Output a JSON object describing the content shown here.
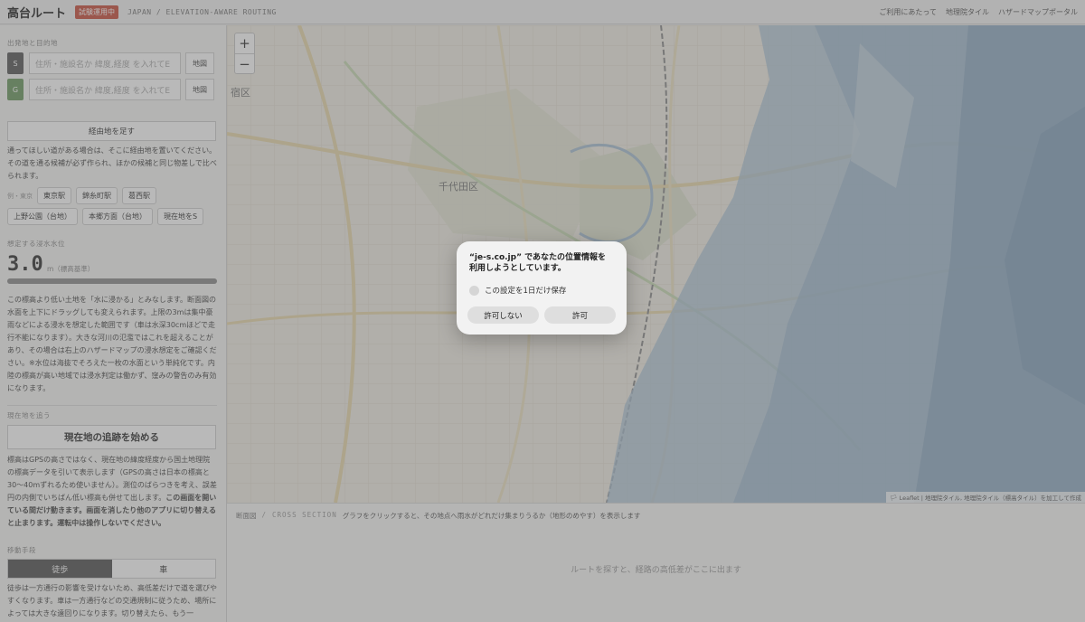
{
  "header": {
    "title": "高台ルート",
    "badge": "試験運用中",
    "subtitle": "JAPAN / ELEVATION-AWARE ROUTING",
    "links": [
      "ご利用にあたって",
      "地理院タイル",
      "ハザードマップポータル"
    ]
  },
  "sidebar": {
    "origin_dest_label": "出発地と目的地",
    "start_badge": "S",
    "goal_badge": "G",
    "input_placeholder": "住所・施設名か 緯度,経度 を入れてE",
    "map_button": "地図",
    "waypoint_button": "経由地を足す",
    "waypoint_help": "通ってほしい道がある場合は、そこに経由地を置いてください。その道を通る候補が必ず作られ、ほかの候補と同じ物差しで比べられます。",
    "examples_lead": "例・東京",
    "examples": [
      "東京駅",
      "錦糸町駅",
      "葛西駅",
      "上野公園（台地）",
      "本郷方面（台地）",
      "現在地をS"
    ],
    "water_label": "想定する浸水水位",
    "water_level_value": "3.0",
    "water_level_unit": "m（標高基準）",
    "water_level_fraction": 1.0,
    "water_help": "この標高より低い土地を「水に浸かる」とみなします。断面図の水面を上下にドラッグしても変えられます。上限の3mは集中豪雨などによる浸水を想定した範囲です（車は水深30cmほどで走行不能になります）。大きな河川の氾濫ではこれを超えることがあり、その場合は右上のハザードマップの浸水想定をご確認ください。※水位は海抜でそろえた一枚の水面という単純化です。内陸の標高が高い地域では浸水判定は働かず、窪みの警告のみ有効になります。",
    "track_label": "現在地を追う",
    "track_button": "現在地の追跡を始める",
    "track_help_plain": "標高はGPSの高さではなく、現在地の緯度経度から国土地理院の標高データを引いて表示します（GPSの高さは日本の標高と30〜40mずれるため使いません）。測位のばらつきを考え、誤差円の内側でいちばん低い標高も併せて出します。",
    "track_help_bold": "この画面を開いている間だけ動きます。画面を消したり他のアプリに切り替えると止まります。運転中は操作しないでください。",
    "mode_label": "移動手段",
    "modes": [
      "徒歩",
      "車"
    ],
    "mode_help": "徒歩は一方通行の影響を受けないため、高低差だけで道を選びやすくなります。車は一方通行などの交通規制に従うため、場所によっては大きな遠回りになります。切り替えたら、もう一"
  },
  "map": {
    "zoom_in": "+",
    "zoom_out": "−",
    "place_labels": [
      "千代田区",
      "宿区"
    ],
    "attribution": "🏳 Leaflet | 地理院タイル, 地理院タイル（標高タイル）を加工して作成"
  },
  "cross_section": {
    "title_jp": "断面図",
    "separator": "/",
    "title_en": "CROSS SECTION",
    "description": "グラフをクリックすると、その地点へ雨水がどれだけ集まりうるか（地形のめやす）を表示します",
    "empty_message": "ルートを探すと、経路の高低差がここに出ます"
  },
  "dialog": {
    "title": "“je-s.co.jp” であなたの位置情報を利用しようとしています。",
    "checkbox_label": "この設定を1日だけ保存",
    "deny_button": "許可しない",
    "allow_button": "許可"
  },
  "colors": {
    "beta_badge": "#c9503f",
    "start_badge": "#5a5a5a",
    "goal_badge": "#6e9a62",
    "flood_water": "#a9c1d5",
    "map_base": "#f1eee5"
  }
}
